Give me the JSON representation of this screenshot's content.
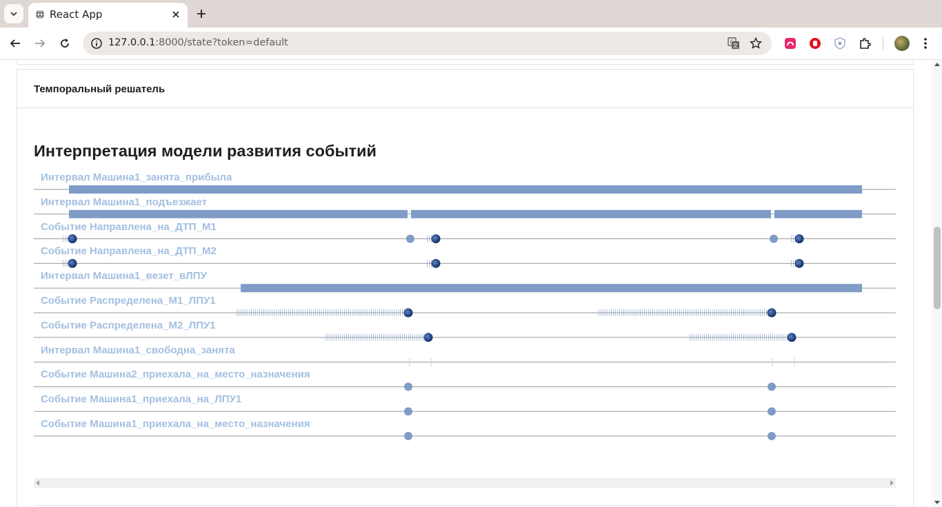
{
  "browser": {
    "tab_title": "React App",
    "url_host": "127.0.0.1",
    "url_rest": ":8000/state?token=default"
  },
  "card": {
    "title": "Темпоральный решатель"
  },
  "section": {
    "title": "Интерпретация модели развития событий"
  },
  "colors": {
    "interval_bar": "#7f9cc7",
    "event_point": "#7f9cc7",
    "event_active": "#1c3f85",
    "label": "#a3bfe0",
    "axis_line": "#9a9a9a"
  },
  "timeline": {
    "rows": [
      {
        "label": "Интервал Машина1_занята_прибыла",
        "type": "interval"
      },
      {
        "label": "Интервал Машина1_подъезжает",
        "type": "interval"
      },
      {
        "label": "Событие Направлена_на_ДТП_М1",
        "type": "event"
      },
      {
        "label": "Событие Направлена_на_ДТП_М2",
        "type": "event"
      },
      {
        "label": "Интервал Машина1_везет_вЛПУ",
        "type": "interval"
      },
      {
        "label": "Событие Распределена_М1_ЛПУ1",
        "type": "event"
      },
      {
        "label": "Событие Распределена_М2_ЛПУ1",
        "type": "event"
      },
      {
        "label": "Интервал Машина1_свободна_занята",
        "type": "interval"
      },
      {
        "label": "Событие Машина2_приехала_на_место_назначения",
        "type": "event"
      },
      {
        "label": "Событие Машина1_приехала_на_ЛПУ1",
        "type": "event"
      },
      {
        "label": "Событие Машина1_приехала_на_место_назначения",
        "type": "event"
      }
    ]
  }
}
